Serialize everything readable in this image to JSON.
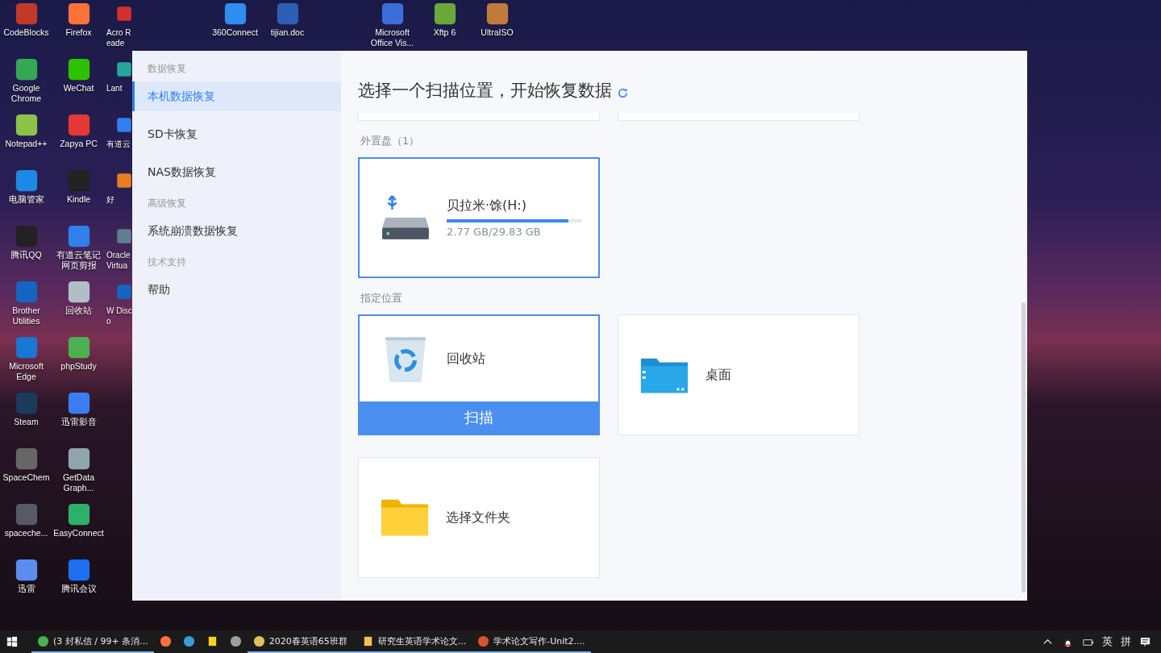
{
  "desktop": {
    "top_row": [
      {
        "label": "360Connect",
        "color": "#2f8df0"
      },
      {
        "label": "tijian.doc",
        "color": "#2b5fb4"
      },
      {
        "label": "Microsoft Office Vis...",
        "color": "#3b6ed8"
      },
      {
        "label": "Xftp 6",
        "color": "#6aa83a"
      },
      {
        "label": "UltraISO",
        "color": "#c07a3a"
      }
    ],
    "columns": [
      [
        {
          "label": "CodeBlocks",
          "color": "#c0392b"
        },
        {
          "label": "Google Chrome",
          "color": "#34a853"
        },
        {
          "label": "Notepad++",
          "color": "#8bc34a"
        },
        {
          "label": "电脑管家",
          "color": "#1e88e5"
        },
        {
          "label": "腾讯QQ",
          "color": "#222222"
        },
        {
          "label": "Brother Utilities",
          "color": "#1565c0"
        },
        {
          "label": "Microsoft Edge",
          "color": "#1976d2"
        },
        {
          "label": "Steam",
          "color": "#1b3a5c"
        },
        {
          "label": "SpaceChem",
          "color": "#666666"
        },
        {
          "label": "spaceche...",
          "color": "#555a66"
        },
        {
          "label": "迅雷",
          "color": "#5b8def"
        }
      ],
      [
        {
          "label": "Firefox",
          "color": "#ff7139"
        },
        {
          "label": "WeChat",
          "color": "#2dc100"
        },
        {
          "label": "Zapya PC",
          "color": "#e53935"
        },
        {
          "label": "Kindle",
          "color": "#222222"
        },
        {
          "label": "有道云笔记网页剪报",
          "color": "#2f80ed"
        },
        {
          "label": "回收站",
          "color": "#b0bec5"
        },
        {
          "label": "phpStudy",
          "color": "#4caf50"
        },
        {
          "label": "迅雷影音",
          "color": "#3d7cf0"
        },
        {
          "label": "GetData Graph...",
          "color": "#90a4ae"
        },
        {
          "label": "EasyConnect",
          "color": "#2eaf6a"
        },
        {
          "label": "腾讯会议",
          "color": "#1e6ff0"
        }
      ],
      [
        {
          "label": "Acro Reade",
          "color": "#d32f2f"
        },
        {
          "label": "Lant",
          "color": "#26a69a"
        },
        {
          "label": "有道云",
          "color": "#2f80ed"
        },
        {
          "label": "好",
          "color": "#e67e22"
        },
        {
          "label": "Oracle Virtua",
          "color": "#607d8b"
        },
        {
          "label": "W Disco",
          "color": "#1565c0"
        }
      ]
    ]
  },
  "sidebar": {
    "groups": [
      {
        "heading": "数据恢复",
        "items": [
          {
            "label": "本机数据恢复",
            "selected": true
          },
          {
            "label": "SD卡恢复",
            "selected": false
          },
          {
            "label": "NAS数据恢复",
            "selected": false
          }
        ]
      },
      {
        "heading": "高级恢复",
        "items": [
          {
            "label": "系统崩溃数据恢复",
            "selected": false
          }
        ]
      },
      {
        "heading": "技术支持",
        "items": [
          {
            "label": "帮助",
            "selected": false
          }
        ]
      }
    ]
  },
  "main": {
    "title": "选择一个扫描位置，开始恢复数据",
    "sections": [
      {
        "title": "外置盘（1）",
        "cards": [
          {
            "kind": "drive",
            "name": "贝拉米·馀(H:)",
            "usage": "2.77 GB/29.83 GB",
            "level": 0.9,
            "selected": true
          }
        ]
      },
      {
        "title": "指定位置",
        "cards": [
          {
            "kind": "recycle",
            "name": "回收站",
            "selected": true,
            "action": "扫描"
          },
          {
            "kind": "desktop",
            "name": "桌面",
            "selected": false
          },
          {
            "kind": "folder",
            "name": "选择文件夹",
            "selected": false
          }
        ]
      }
    ]
  },
  "taskbar": {
    "apps": [
      {
        "kind": "chrome",
        "label": "(3 封私信 / 99+ 条消...",
        "open": true
      },
      {
        "kind": "firefox",
        "open": false
      },
      {
        "kind": "edge",
        "open": false
      },
      {
        "kind": "note",
        "open": false
      },
      {
        "kind": "clock",
        "open": false
      },
      {
        "kind": "chat",
        "label": "2020春英语65班群",
        "open": true
      },
      {
        "kind": "file",
        "label": "研究生英语学术论文...",
        "open": true
      },
      {
        "kind": "slides",
        "label": "学术论文写作-Unit2....",
        "open": true
      }
    ],
    "tray": [
      "英",
      "拼"
    ]
  }
}
